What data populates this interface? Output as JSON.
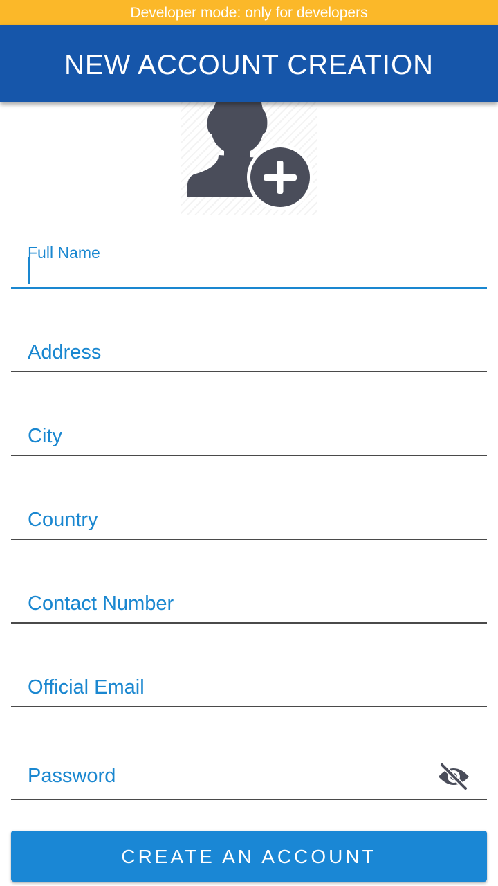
{
  "banner": {
    "text": "Developer mode: only for developers"
  },
  "header": {
    "title": "NEW ACCOUNT CREATION"
  },
  "avatar": {
    "icon": "add-user-icon"
  },
  "form": {
    "full_name": {
      "label": "Full Name",
      "value": ""
    },
    "address": {
      "label": "Address",
      "value": ""
    },
    "city": {
      "label": "City",
      "value": ""
    },
    "country": {
      "label": "Country",
      "value": ""
    },
    "contact": {
      "label": "Contact Number",
      "value": ""
    },
    "email": {
      "label": "Official Email",
      "value": ""
    },
    "password": {
      "label": "Password",
      "value": "",
      "toggle_icon": "eye-off-icon"
    }
  },
  "submit": {
    "label": "CREATE AN ACCOUNT"
  },
  "colors": {
    "banner": "#fbb829",
    "app_bar": "#1656aa",
    "accent": "#1a87d0",
    "button": "#1a87d5",
    "icon": "#4a4d5a"
  }
}
